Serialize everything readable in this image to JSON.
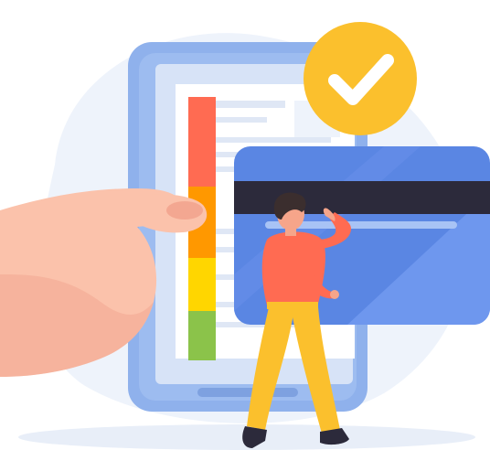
{
  "illustration": {
    "subject": "hand-holding-phone-with-credit-card-and-person",
    "icons": [
      "phone-icon",
      "credit-card-icon",
      "checkmark-badge-icon",
      "rating-meter-icon",
      "person-figure",
      "hand"
    ],
    "colors": {
      "background_blob": "#eef3fb",
      "phone_frame": "#8fb1ec",
      "phone_frame_dark": "#7ea1e0",
      "phone_screen": "#d7e3f7",
      "phone_paper": "#ffffff",
      "phone_line": "#dfe7f5",
      "card_body": "#5a86e3",
      "card_highlight": "#6e97ee",
      "card_stripe": "#2c2a3b",
      "card_line": "#a8c3f5",
      "badge": "#fbc02d",
      "check": "#ffffff",
      "meter_red": "#ff6b52",
      "meter_orange": "#ff9800",
      "meter_yellow": "#ffd600",
      "meter_green": "#8bc34a",
      "skin": "#fbc2ab",
      "skin_shadow": "#f3a791",
      "person_shirt": "#ff6b52",
      "person_pants": "#fbc02d",
      "person_hair": "#3b2e2e",
      "person_skin": "#f6a58a",
      "shoes": "#2c2a3b",
      "ground": "#e8eef8"
    },
    "meter_levels": [
      "red",
      "orange",
      "yellow",
      "green"
    ]
  }
}
